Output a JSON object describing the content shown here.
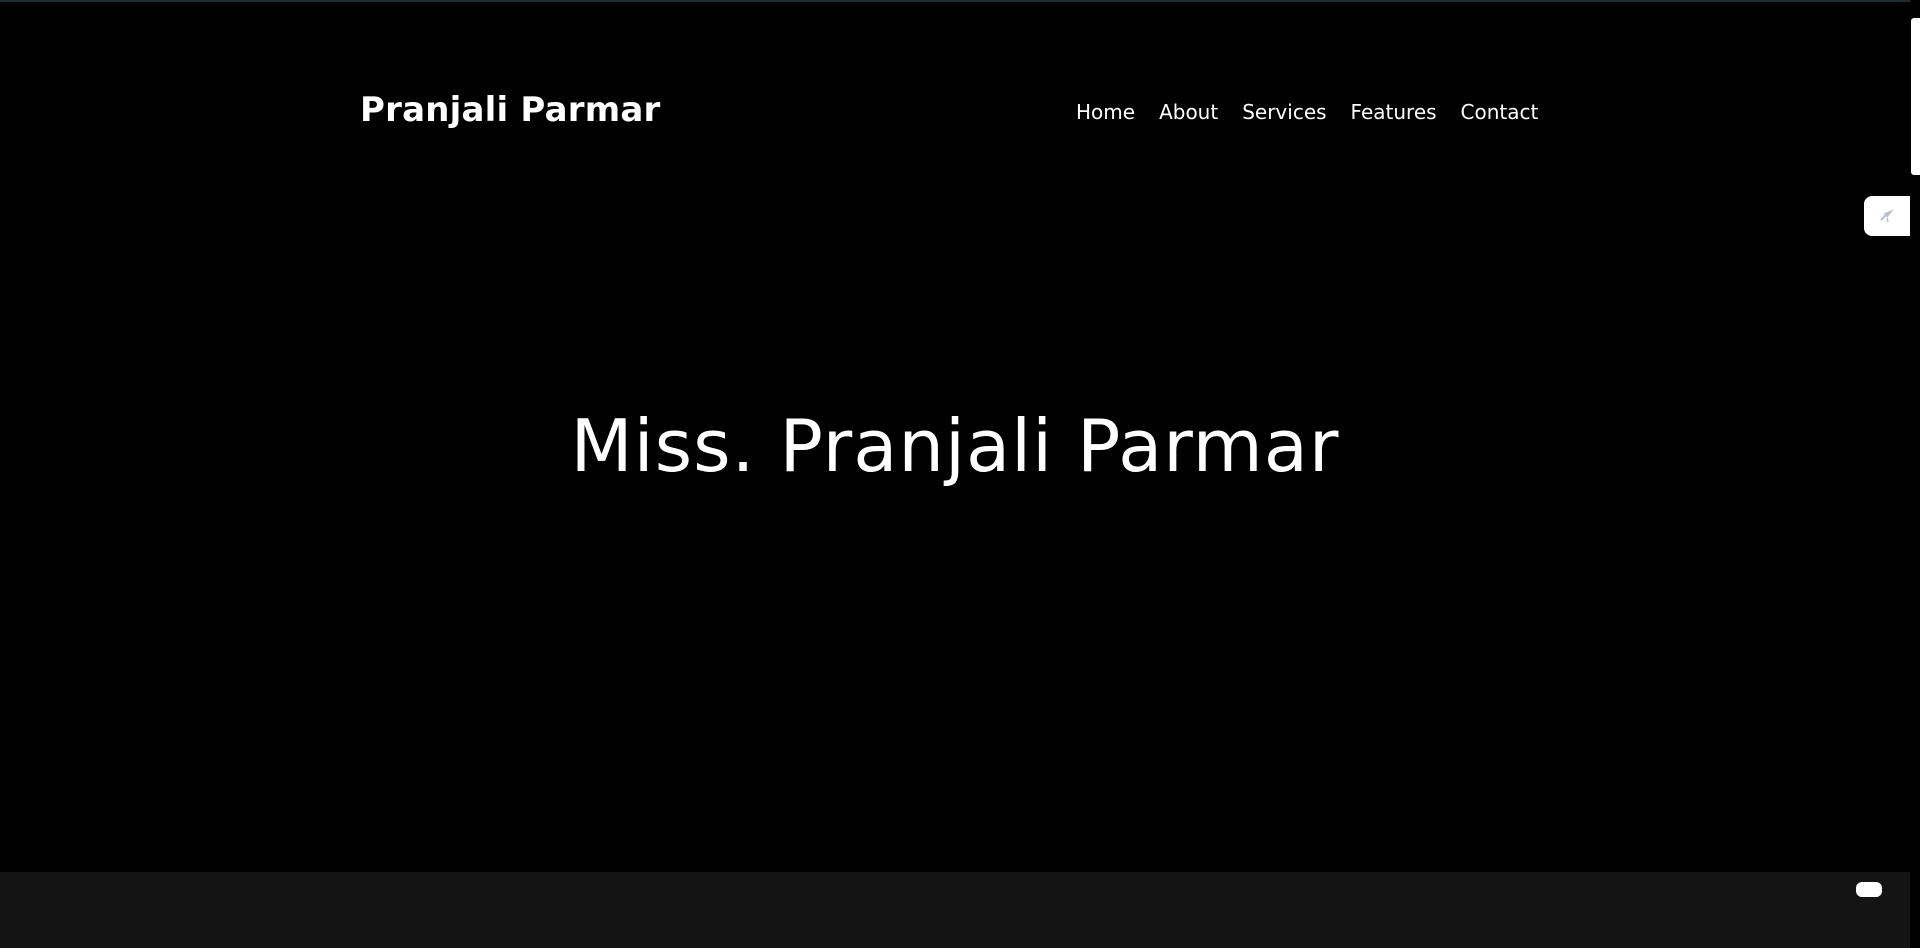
{
  "header": {
    "brand": "Pranjali Parmar",
    "nav": [
      {
        "label": "Home"
      },
      {
        "label": "About"
      },
      {
        "label": "Services"
      },
      {
        "label": "Features"
      },
      {
        "label": "Contact"
      }
    ]
  },
  "hero": {
    "title": "Miss. Pranjali Parmar"
  },
  "widgets": {
    "side_tab_icon": "rocket-icon",
    "chat_icon": "chat-bubble-icon"
  },
  "colors": {
    "background": "#000000",
    "text": "#ffffff",
    "footer_band": "#141414"
  }
}
